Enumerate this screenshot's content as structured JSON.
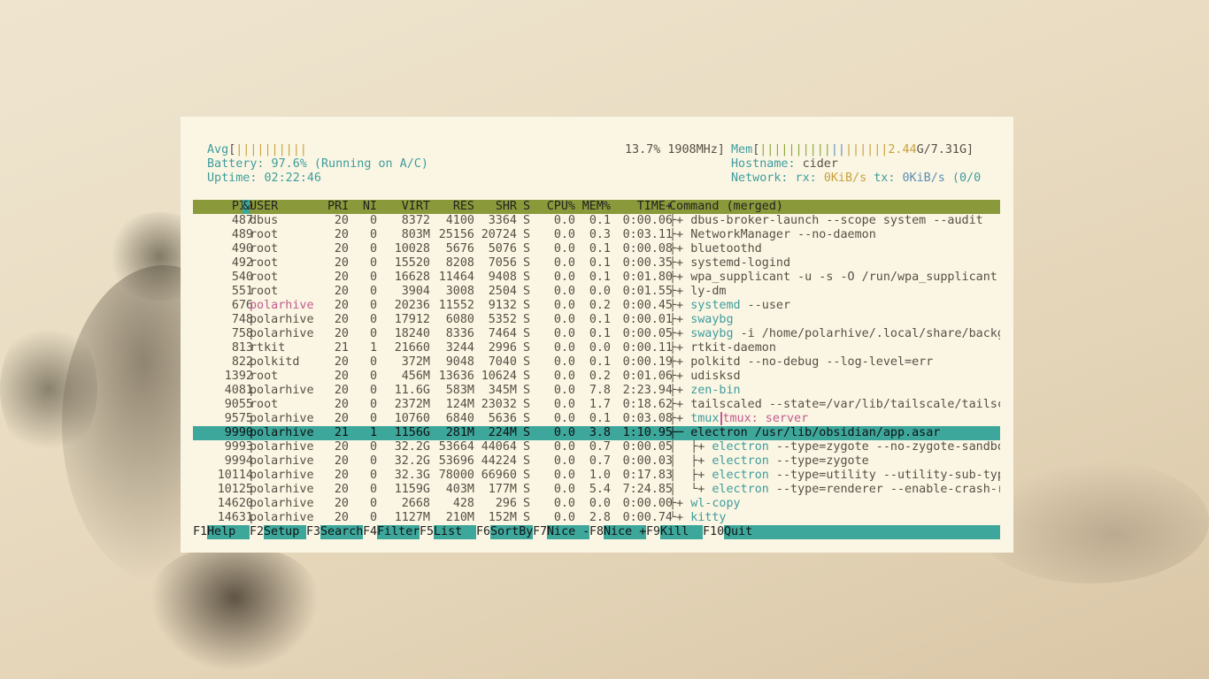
{
  "meters": {
    "avg_label": "Avg",
    "avg_bar": "||||||||||",
    "cpu_text": "13.7% 1908MHz]",
    "battery": "Battery: 97.6% (Running on A/C)",
    "uptime_label": "Uptime: ",
    "uptime_value": "02:22:46",
    "mem_label": "Mem",
    "mem_bar": "||||||||||||||||||",
    "mem_used": "2.44",
    "mem_rest": "G/7.31G]",
    "hostname_label": "Hostname: ",
    "hostname_value": "cider",
    "network_label": "Network: rx: ",
    "network_rx": "0KiB/s",
    "network_tx_label": " tx: ",
    "network_tx": "0KiB/s",
    "network_tail": " (0/0"
  },
  "columns": {
    "pid": "PID",
    "user": "USER",
    "pri": "PRI",
    "ni": "NI",
    "virt": "VIRT",
    "res": "RES",
    "shr": "SHR",
    "s": "S",
    "cpu": "CPU%",
    "mem": "MEM%",
    "time": "TIME+",
    "cmd": "Command (merged)"
  },
  "processes": [
    {
      "pid": "487",
      "user": "dbus",
      "pri": "20",
      "ni": "0",
      "virt": "8372",
      "res": "4100",
      "shr": "3364",
      "s": "S",
      "cpu": "0.0",
      "mem": "0.1",
      "time": "0:00.06",
      "tree": "├+ ",
      "cmd": "dbus-broker-launch --scope system --audit",
      "cmd2": ""
    },
    {
      "pid": "489",
      "user": "root",
      "pri": "20",
      "ni": "0",
      "virt": "803M",
      "res": "25156",
      "shr": "20724",
      "s": "S",
      "cpu": "0.0",
      "mem": "0.3",
      "time": "0:03.11",
      "tree": "├+ ",
      "cmd": "NetworkManager --no-daemon",
      "cmd2": ""
    },
    {
      "pid": "490",
      "user": "root",
      "pri": "20",
      "ni": "0",
      "virt": "10028",
      "res": "5676",
      "shr": "5076",
      "s": "S",
      "cpu": "0.0",
      "mem": "0.1",
      "time": "0:00.08",
      "tree": "├+ ",
      "cmd": "bluetoothd",
      "cmd2": ""
    },
    {
      "pid": "492",
      "user": "root",
      "pri": "20",
      "ni": "0",
      "virt": "15520",
      "res": "8208",
      "shr": "7056",
      "s": "S",
      "cpu": "0.0",
      "mem": "0.1",
      "time": "0:00.35",
      "tree": "├+ ",
      "cmd": "systemd-logind",
      "cmd2": ""
    },
    {
      "pid": "540",
      "user": "root",
      "pri": "20",
      "ni": "0",
      "virt": "16628",
      "res": "11464",
      "shr": "9408",
      "s": "S",
      "cpu": "0.0",
      "mem": "0.1",
      "time": "0:01.80",
      "tree": "├+ ",
      "cmd": "wpa_supplicant -u -s -O /run/wpa_supplicant",
      "cmd2": ""
    },
    {
      "pid": "551",
      "user": "root",
      "pri": "20",
      "ni": "0",
      "virt": "3904",
      "res": "3008",
      "shr": "2504",
      "s": "S",
      "cpu": "0.0",
      "mem": "0.0",
      "time": "0:01.55",
      "tree": "├+ ",
      "cmd": "ly-dm",
      "cmd2": ""
    },
    {
      "pid": "676",
      "user": "polarhive",
      "pri": "20",
      "ni": "0",
      "virt": "20236",
      "res": "11552",
      "shr": "9132",
      "s": "S",
      "cpu": "0.0",
      "mem": "0.2",
      "time": "0:00.45",
      "tree": "├+ ",
      "cmd": "systemd",
      "cmd2": " --user"
    },
    {
      "pid": "748",
      "user": "polarhive",
      "pri": "20",
      "ni": "0",
      "virt": "17912",
      "res": "6080",
      "shr": "5352",
      "s": "S",
      "cpu": "0.0",
      "mem": "0.1",
      "time": "0:00.01",
      "tree": "├+ ",
      "cmd": "swaybg",
      "cmd2": ""
    },
    {
      "pid": "758",
      "user": "polarhive",
      "pri": "20",
      "ni": "0",
      "virt": "18240",
      "res": "8336",
      "shr": "7464",
      "s": "S",
      "cpu": "0.0",
      "mem": "0.1",
      "time": "0:00.05",
      "tree": "├+ ",
      "cmd": "swaybg",
      "cmd2": " -i /home/polarhive/.local/share/backg"
    },
    {
      "pid": "813",
      "user": "rtkit",
      "pri": "21",
      "ni": "1",
      "virt": "21660",
      "res": "3244",
      "shr": "2996",
      "s": "S",
      "cpu": "0.0",
      "mem": "0.0",
      "time": "0:00.11",
      "tree": "├+ ",
      "cmd": "rtkit-daemon",
      "cmd2": ""
    },
    {
      "pid": "822",
      "user": "polkitd",
      "pri": "20",
      "ni": "0",
      "virt": "372M",
      "res": "9048",
      "shr": "7040",
      "s": "S",
      "cpu": "0.0",
      "mem": "0.1",
      "time": "0:00.19",
      "tree": "├+ ",
      "cmd": "polkitd --no-debug --log-level=err",
      "cmd2": ""
    },
    {
      "pid": "1392",
      "user": "root",
      "pri": "20",
      "ni": "0",
      "virt": "456M",
      "res": "13636",
      "shr": "10624",
      "s": "S",
      "cpu": "0.0",
      "mem": "0.2",
      "time": "0:01.06",
      "tree": "├+ ",
      "cmd": "udisksd",
      "cmd2": ""
    },
    {
      "pid": "4081",
      "user": "polarhive",
      "pri": "20",
      "ni": "0",
      "virt": "11.6G",
      "res": "583M",
      "shr": "345M",
      "s": "S",
      "cpu": "0.0",
      "mem": "7.8",
      "time": "2:23.94",
      "tree": "├+ ",
      "cmd": "zen-bin",
      "cmd2": ""
    },
    {
      "pid": "9055",
      "user": "root",
      "pri": "20",
      "ni": "0",
      "virt": "2372M",
      "res": "124M",
      "shr": "23032",
      "s": "S",
      "cpu": "0.0",
      "mem": "1.7",
      "time": "0:18.62",
      "tree": "├+ ",
      "cmd": "tailscaled --state=/var/lib/tailscale/tailsc",
      "cmd2": ""
    },
    {
      "pid": "9575",
      "user": "polarhive",
      "pri": "20",
      "ni": "0",
      "virt": "10760",
      "res": "6840",
      "shr": "5636",
      "s": "S",
      "cpu": "0.0",
      "mem": "0.1",
      "time": "0:03.08",
      "tree": "├+ ",
      "cmd": "tmux",
      "cmd2": "tmux: server"
    },
    {
      "pid": "9990",
      "user": "polarhive",
      "pri": "21",
      "ni": "1",
      "virt": "1156G",
      "res": "281M",
      "shr": "224M",
      "s": "S",
      "cpu": "0.0",
      "mem": "3.8",
      "time": "1:10.95",
      "tree": "├─ ",
      "cmd": "electron /usr/lib/obsidian/app.asar",
      "cmd2": ""
    },
    {
      "pid": "9993",
      "user": "polarhive",
      "pri": "20",
      "ni": "0",
      "virt": "32.2G",
      "res": "53664",
      "shr": "44064",
      "s": "S",
      "cpu": "0.0",
      "mem": "0.7",
      "time": "0:00.05",
      "tree": "│  ├+ ",
      "cmd": "electron",
      "cmd2": " --type=zygote --no-zygote-sandbo"
    },
    {
      "pid": "9994",
      "user": "polarhive",
      "pri": "20",
      "ni": "0",
      "virt": "32.2G",
      "res": "53696",
      "shr": "44224",
      "s": "S",
      "cpu": "0.0",
      "mem": "0.7",
      "time": "0:00.03",
      "tree": "│  ├+ ",
      "cmd": "electron",
      "cmd2": " --type=zygote"
    },
    {
      "pid": "10114",
      "user": "polarhive",
      "pri": "20",
      "ni": "0",
      "virt": "32.3G",
      "res": "78000",
      "shr": "66960",
      "s": "S",
      "cpu": "0.0",
      "mem": "1.0",
      "time": "0:17.83",
      "tree": "│  ├+ ",
      "cmd": "electron",
      "cmd2": " --type=utility --utility-sub-typ"
    },
    {
      "pid": "10125",
      "user": "polarhive",
      "pri": "20",
      "ni": "0",
      "virt": "1159G",
      "res": "403M",
      "shr": "177M",
      "s": "S",
      "cpu": "0.0",
      "mem": "5.4",
      "time": "7:24.85",
      "tree": "│  └+ ",
      "cmd": "electron",
      "cmd2": " --type=renderer --enable-crash-r"
    },
    {
      "pid": "14620",
      "user": "polarhive",
      "pri": "20",
      "ni": "0",
      "virt": "2668",
      "res": "428",
      "shr": "296",
      "s": "S",
      "cpu": "0.0",
      "mem": "0.0",
      "time": "0:00.00",
      "tree": "├+ ",
      "cmd": "wl-copy",
      "cmd2": ""
    },
    {
      "pid": "14631",
      "user": "polarhive",
      "pri": "20",
      "ni": "0",
      "virt": "1127M",
      "res": "210M",
      "shr": "152M",
      "s": "S",
      "cpu": "0.0",
      "mem": "2.8",
      "time": "0:00.74",
      "tree": "└+ ",
      "cmd": "kitty",
      "cmd2": ""
    }
  ],
  "selected_row": 15,
  "fkeys": [
    {
      "key": "F1",
      "label": "Help  "
    },
    {
      "key": "F2",
      "label": "Setup "
    },
    {
      "key": "F3",
      "label": "Search"
    },
    {
      "key": "F4",
      "label": "Filter"
    },
    {
      "key": "F5",
      "label": "List  "
    },
    {
      "key": "F6",
      "label": "SortBy"
    },
    {
      "key": "F7",
      "label": "Nice -"
    },
    {
      "key": "F8",
      "label": "Nice +"
    },
    {
      "key": "F9",
      "label": "Kill  "
    },
    {
      "key": "F10",
      "label": "Quit"
    }
  ],
  "colors": {
    "header_bg": "#8a9a3a",
    "selection_bg": "#3da79c",
    "terminal_bg": "#fbf6e4"
  }
}
